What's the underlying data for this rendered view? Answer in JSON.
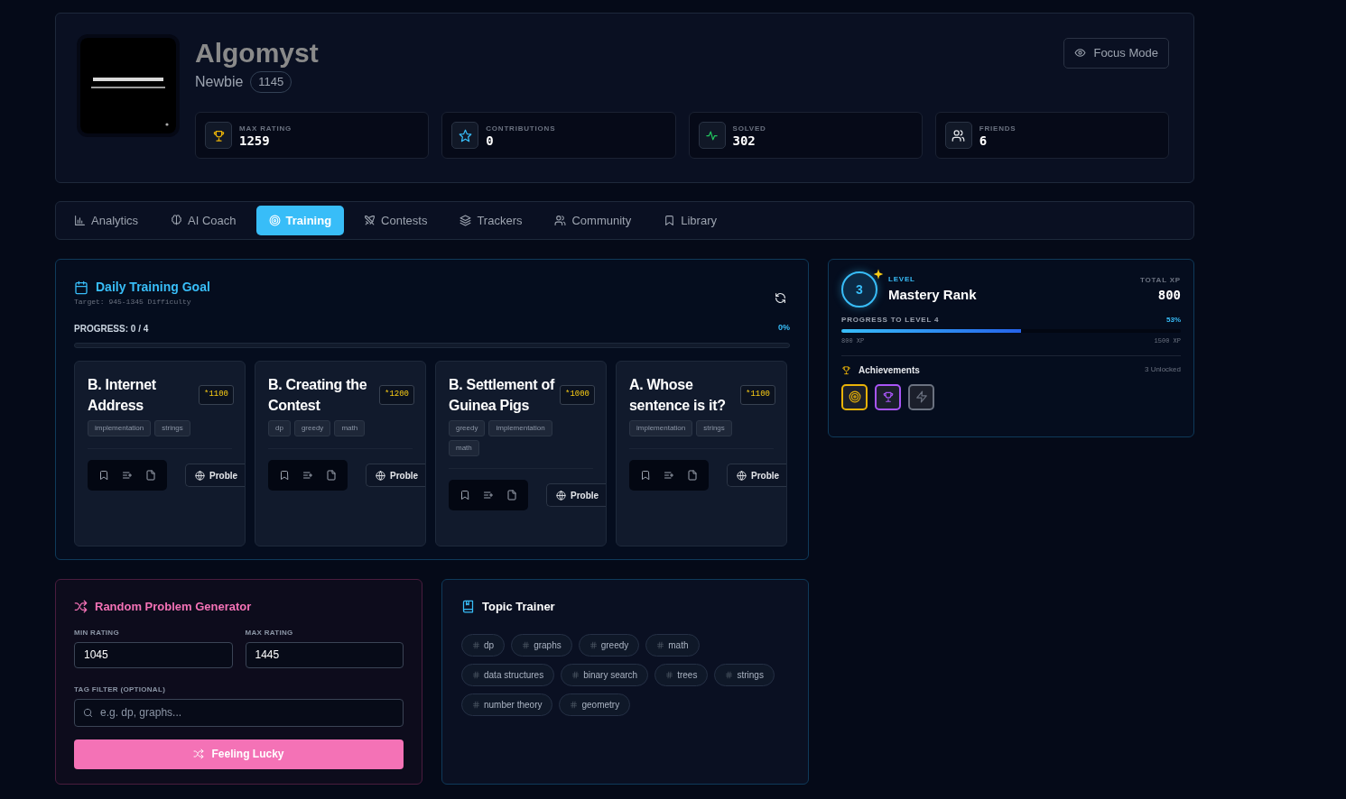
{
  "profile": {
    "handle": "Algomyst",
    "rank": "Newbie",
    "rating": "1145",
    "focus_button": "Focus Mode"
  },
  "stats": [
    {
      "kind": "rating",
      "label": "MAX RATING",
      "value": "1259"
    },
    {
      "kind": "contributions",
      "label": "CONTRIBUTIONS",
      "value": "0"
    },
    {
      "kind": "solved",
      "label": "SOLVED",
      "value": "302"
    },
    {
      "kind": "friends",
      "label": "FRIENDS",
      "value": "6"
    }
  ],
  "tabs": [
    {
      "kind": "analytics",
      "label": "Analytics",
      "selected": false
    },
    {
      "kind": "coach",
      "label": "AI Coach",
      "selected": false
    },
    {
      "kind": "training",
      "label": "Training",
      "selected": true
    },
    {
      "kind": "contests",
      "label": "Contests",
      "selected": false
    },
    {
      "kind": "trackers",
      "label": "Trackers",
      "selected": false
    },
    {
      "kind": "community",
      "label": "Community",
      "selected": false
    },
    {
      "kind": "library",
      "label": "Library",
      "selected": false
    }
  ],
  "daily_goal": {
    "title": "Daily Training Goal",
    "subtitle": "Target: 945-1345 Difficulty",
    "progress_label": "PROGRESS: 0 / 4",
    "percent": "0%",
    "level": 0,
    "problems": [
      {
        "title": "B. Internet Address",
        "rating": "*1100",
        "tags": [
          "implementation",
          "strings"
        ],
        "link": "Proble"
      },
      {
        "title": "B. Creating the Contest",
        "rating": "*1200",
        "tags": [
          "dp",
          "greedy",
          "math"
        ],
        "link": "Proble"
      },
      {
        "title": "B. Settlement of Guinea Pigs",
        "rating": "*1000",
        "tags": [
          "greedy",
          "implementation",
          "math"
        ],
        "link": "Proble"
      },
      {
        "title": "A. Whose sentence is it?",
        "rating": "*1100",
        "tags": [
          "implementation",
          "strings"
        ],
        "link": "Proble"
      }
    ]
  },
  "level_card": {
    "level": "3",
    "level_label": "LEVEL",
    "rank": "Mastery Rank",
    "xp_label": "TOTAL XP",
    "xp": "800",
    "progress_label": "PROGRESS TO LEVEL 4",
    "percent": "53%",
    "progress": {
      "level": 0.53
    },
    "xp_from": "800 XP",
    "xp_to": "1500 XP",
    "achievements_title": "Achievements",
    "unlocked": "3 Unlocked",
    "achievements": [
      {
        "kind": "target",
        "color": "#eab308"
      },
      {
        "kind": "trophy",
        "color": "#a855f7"
      },
      {
        "kind": "bolt",
        "color": "#6b7280"
      }
    ]
  },
  "random_generator": {
    "title": "Random Problem Generator",
    "min_label": "MIN RATING",
    "min_value": "1045",
    "max_label": "MAX RATING",
    "max_value": "1445",
    "tag_label": "TAG FILTER (OPTIONAL)",
    "tag_placeholder": "e.g. dp, graphs...",
    "button": "Feeling Lucky"
  },
  "topic_trainer": {
    "title": "Topic Trainer",
    "topics": [
      "dp",
      "graphs",
      "greedy",
      "math",
      "data structures",
      "binary search",
      "trees",
      "strings",
      "number theory",
      "geometry"
    ]
  }
}
